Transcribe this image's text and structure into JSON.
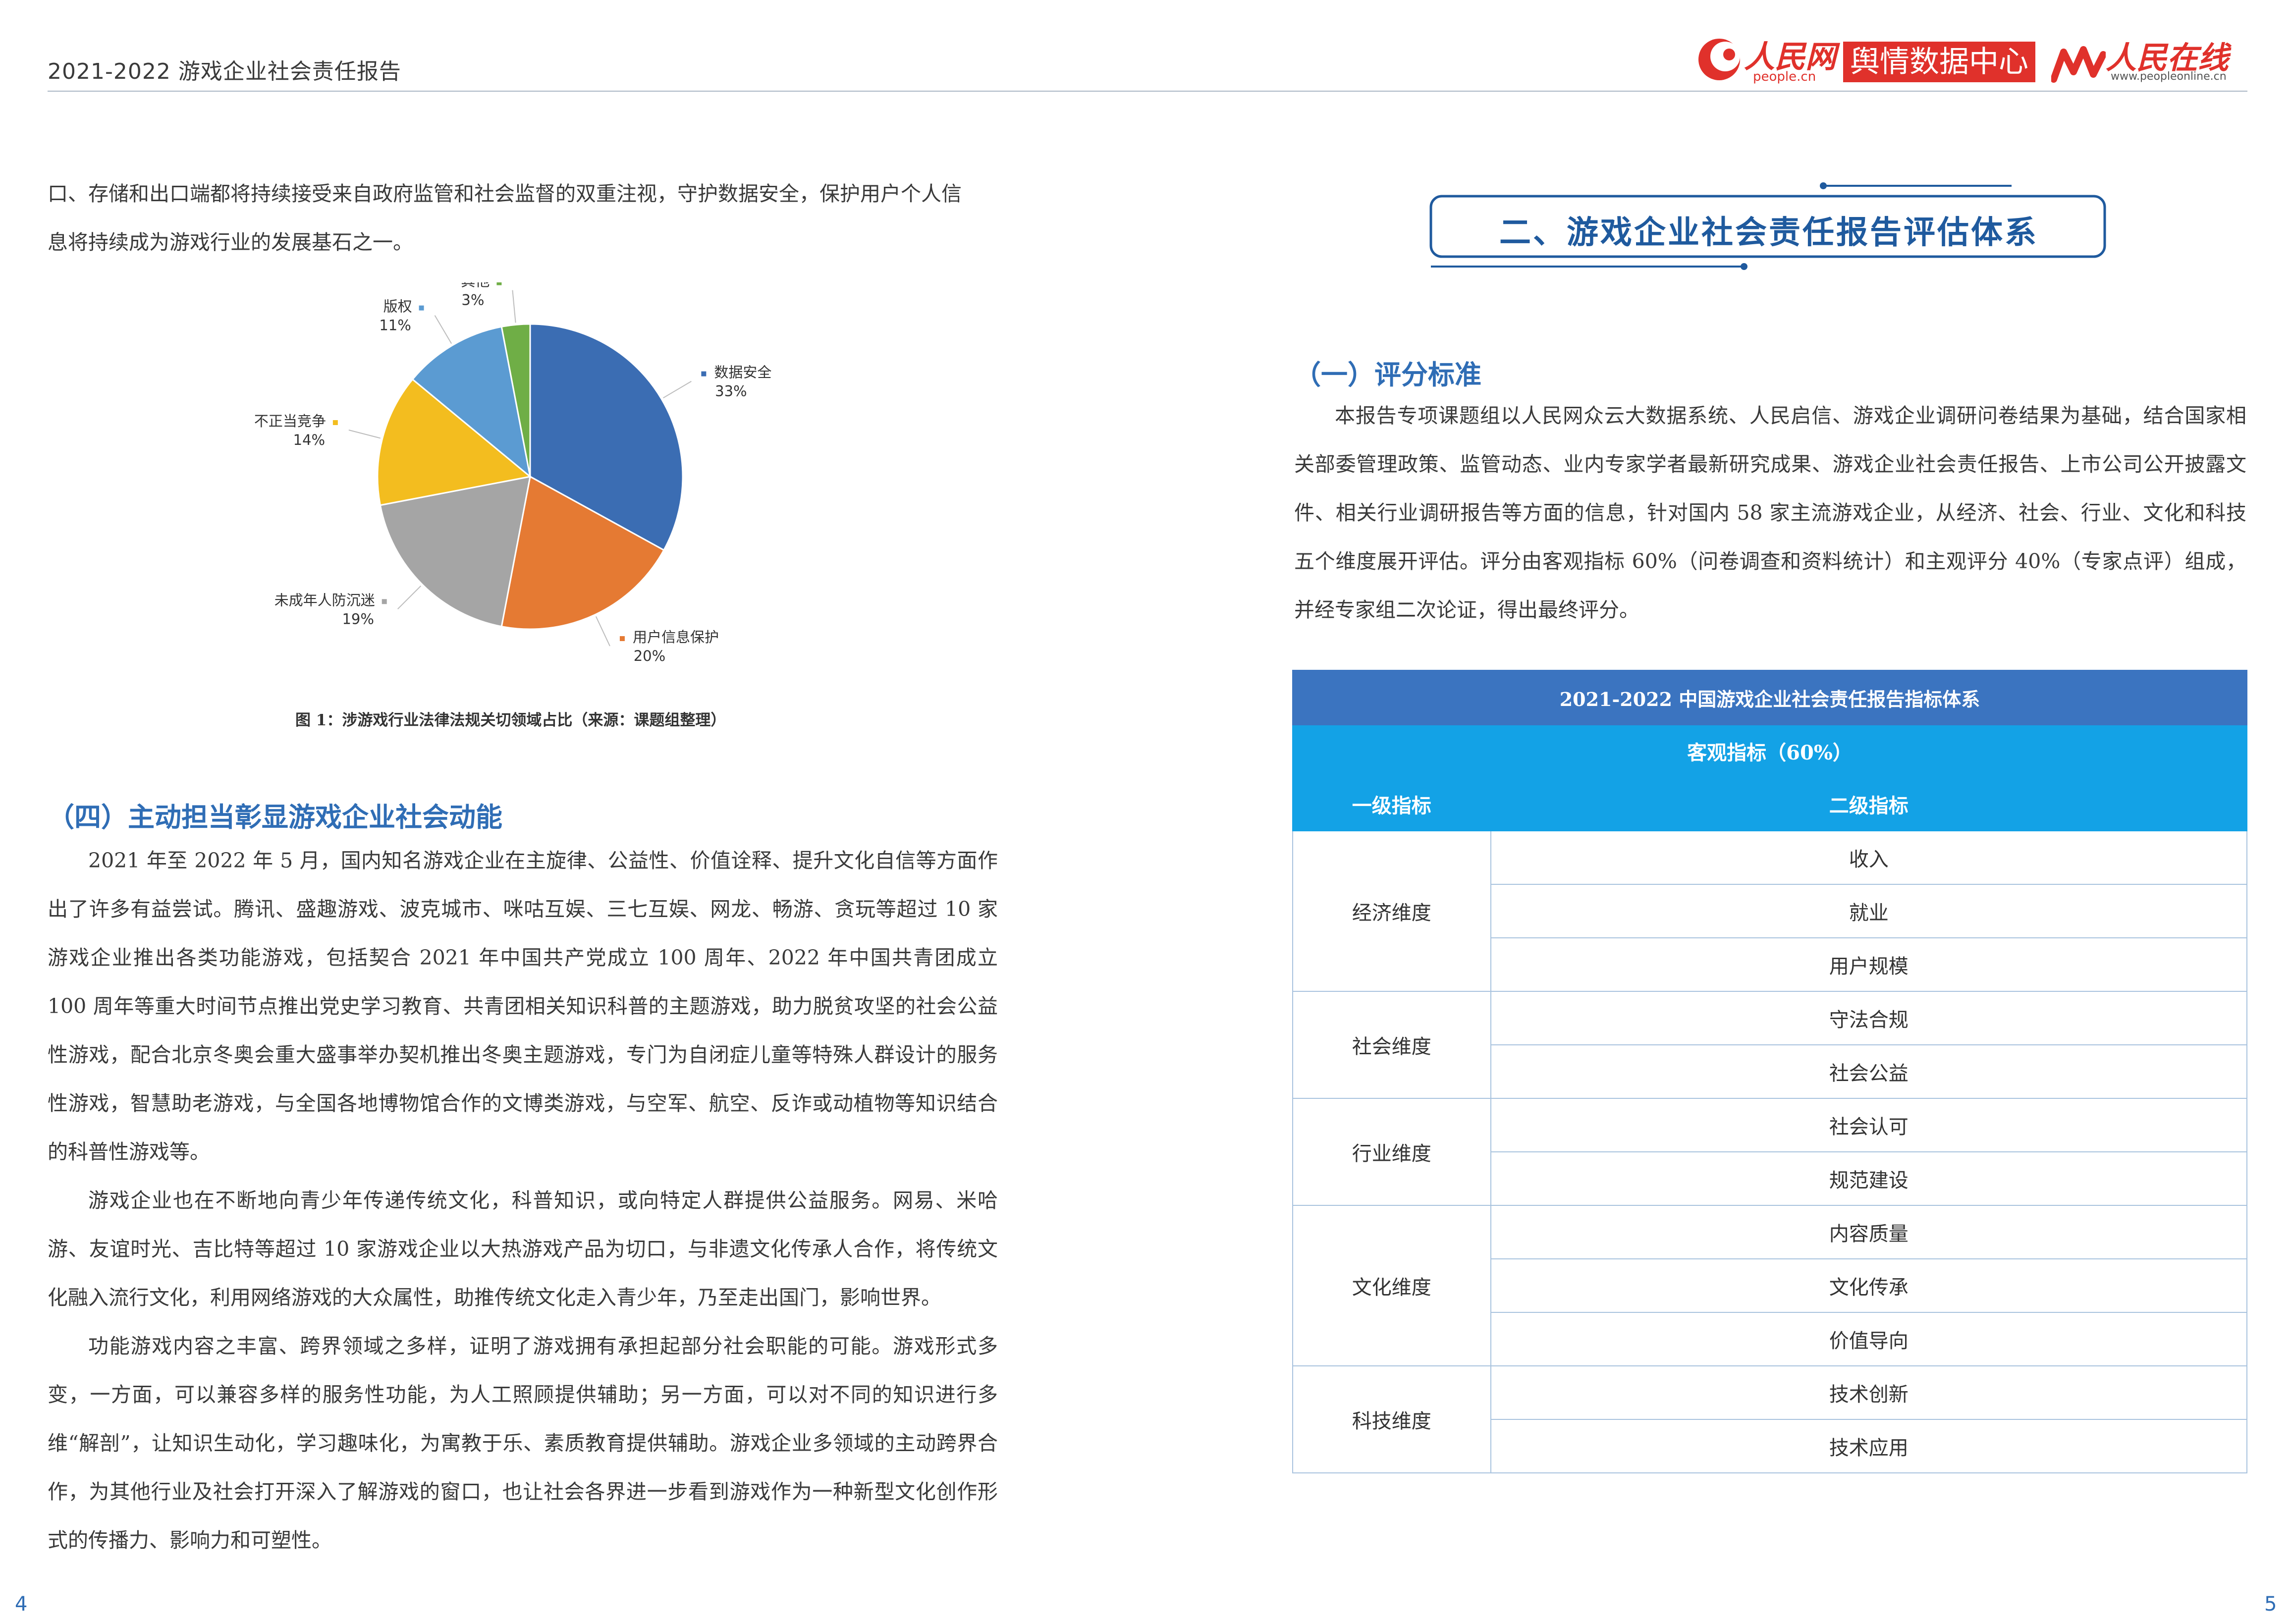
{
  "header": {
    "title": "2021-2022 游戏企业社会责任报告",
    "logo_people_cn": "人民网",
    "logo_people_url": "people.cn",
    "logo_center": "舆情数据中心",
    "logo_online": "人民在线",
    "logo_online_url": "www.peopleonline.cn"
  },
  "left": {
    "intro_lines": [
      "口、存储和出口端都将持续接受来自政府监管和社会监督的双重注视，守护数据安全，保护用户个人信",
      "息将持续成为游戏行业的发展基石之一。"
    ],
    "figure_caption": "图 1：涉游戏行业法律法规关切领域占比（来源：课题组整理）",
    "section_heading": "（四）主动担当彰显游戏企业社会动能",
    "paragraphs": [
      "2021 年至 2022 年 5 月，国内知名游戏企业在主旋律、公益性、价值诠释、提升文化自信等方面作出了许多有益尝试。腾讯、盛趣游戏、波克城市、咪咕互娱、三七互娱、网龙、畅游、贪玩等超过 10 家游戏企业推出各类功能游戏，包括契合 2021 年中国共产党成立 100 周年、2022 年中国共青团成立 100 周年等重大时间节点推出党史学习教育、共青团相关知识科普的主题游戏，助力脱贫攻坚的社会公益性游戏，配合北京冬奥会重大盛事举办契机推出冬奥主题游戏，专门为自闭症儿童等特殊人群设计的服务性游戏，智慧助老游戏，与全国各地博物馆合作的文博类游戏，与空军、航空、反诈或动植物等知识结合的科普性游戏等。",
      "游戏企业也在不断地向青少年传递传统文化，科普知识，或向特定人群提供公益服务。网易、米哈游、友谊时光、吉比特等超过 10 家游戏企业以大热游戏产品为切口，与非遗文化传承人合作，将传统文化融入流行文化，利用网络游戏的大众属性，助推传统文化走入青少年，乃至走出国门，影响世界。",
      "功能游戏内容之丰富、跨界领域之多样，证明了游戏拥有承担起部分社会职能的可能。游戏形式多变，一方面，可以兼容多样的服务性功能，为人工照顾提供辅助；另一方面，可以对不同的知识进行多维“解剖”，让知识生动化，学习趣味化，为寓教于乐、素质教育提供辅助。游戏企业多领域的主动跨界合作，为其他行业及社会打开深入了解游戏的窗口，也让社会各界进一步看到游戏作为一种新型文化创作形式的传播力、影响力和可塑性。"
    ],
    "page_number": "4"
  },
  "chart_data": {
    "type": "pie",
    "title": "",
    "categories": [
      "数据安全",
      "用户信息保护",
      "未成年人防沉迷",
      "不正当竞争",
      "版权",
      "其他"
    ],
    "values": [
      33,
      20,
      19,
      14,
      11,
      3
    ],
    "value_labels": [
      "33%",
      "20%",
      "19%",
      "14%",
      "11%",
      "3%"
    ],
    "colors": [
      "#3b6db3",
      "#e57a33",
      "#a5a5a5",
      "#f3bd1f",
      "#5b9bd2",
      "#6fae46"
    ],
    "legend": "labels beside slices"
  },
  "right": {
    "banner": "二、游戏企业社会责任报告评估体系",
    "subheading": "（一）评分标准",
    "paragraph": "本报告专项课题组以人民网众云大数据系统、人民启信、游戏企业调研问卷结果为基础，结合国家相关部委管理政策、监管动态、业内专家学者最新研究成果、游戏企业社会责任报告、上市公司公开披露文件、相关行业调研报告等方面的信息，针对国内 58 家主流游戏企业，从经济、社会、行业、文化和科技五个维度展开评估。评分由客观指标 60%（问卷调查和资料统计）和主观评分 40%（专家点评）组成，并经专家组二次论证，得出最终评分。",
    "table": {
      "title": "2021-2022 中国游戏企业社会责任报告指标体系",
      "subtitle": "客观指标（60%）",
      "col1": "一级指标",
      "col2": "二级指标",
      "groups": [
        {
          "name": "经济维度",
          "items": [
            "收入",
            "就业",
            "用户规模"
          ]
        },
        {
          "name": "社会维度",
          "items": [
            "守法合规",
            "社会公益"
          ]
        },
        {
          "name": "行业维度",
          "items": [
            "社会认可",
            "规范建设"
          ]
        },
        {
          "name": "文化维度",
          "items": [
            "内容质量",
            "文化传承",
            "价值导向"
          ]
        },
        {
          "name": "科技维度",
          "items": [
            "技术创新",
            "技术应用"
          ]
        }
      ]
    },
    "page_number": "5"
  }
}
